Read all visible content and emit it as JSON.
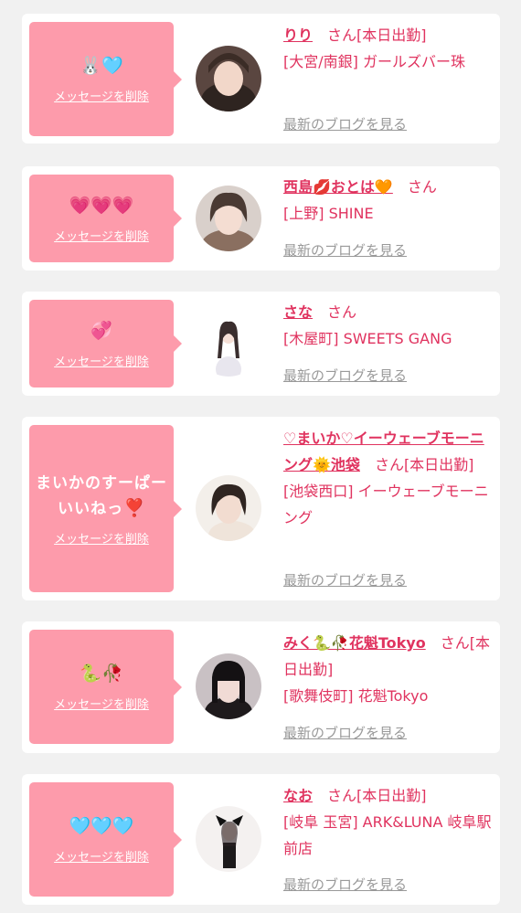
{
  "colors": {
    "accent": "#e0335f",
    "bubble": "#fd9bab",
    "link_gray": "#999999"
  },
  "cards": [
    {
      "message": "",
      "message_emoji": "🐰🩵",
      "delete_label": "メッセージを削除",
      "name": "りり",
      "suffix": "　さん[本日出勤]",
      "shop": "[大宮/南銀] ガールズバー珠",
      "blog_label": "最新のブログを見る"
    },
    {
      "message": "",
      "message_emoji": "💗💗💗",
      "delete_label": "メッセージを削除",
      "name": "西島💋おとは🧡",
      "suffix": "　さん",
      "shop": "[上野] SHINE",
      "blog_label": "最新のブログを見る"
    },
    {
      "message": "",
      "message_emoji": "💞",
      "delete_label": "メッセージを削除",
      "name": "さな",
      "suffix": "　さん",
      "shop": "[木屋町] SWEETS GANG",
      "blog_label": "最新のブログを見る"
    },
    {
      "message": "まいかのすーぱーいいねっ",
      "message_emoji": "❣️",
      "delete_label": "メッセージを削除",
      "name": "♡まいか♡イーウェーブモーニング🌞池袋",
      "suffix": "　さん[本日出勤]",
      "shop": "[池袋西口] イーウェーブモーニング",
      "blog_label": "最新のブログを見る"
    },
    {
      "message": "",
      "message_emoji": "🐍🥀",
      "delete_label": "メッセージを削除",
      "name": "みく🐍🥀花魁Tokyo",
      "suffix": "　さん[本日出勤]",
      "shop": "[歌舞伎町] 花魁Tokyo",
      "blog_label": "最新のブログを見る"
    },
    {
      "message": "",
      "message_emoji": "🩵🩵🩵",
      "delete_label": "メッセージを削除",
      "name": "なお",
      "suffix": "　さん[本日出勤]",
      "shop": "[岐阜 玉宮] ARK&LUNA 岐阜駅前店",
      "blog_label": "最新のブログを見る"
    }
  ]
}
